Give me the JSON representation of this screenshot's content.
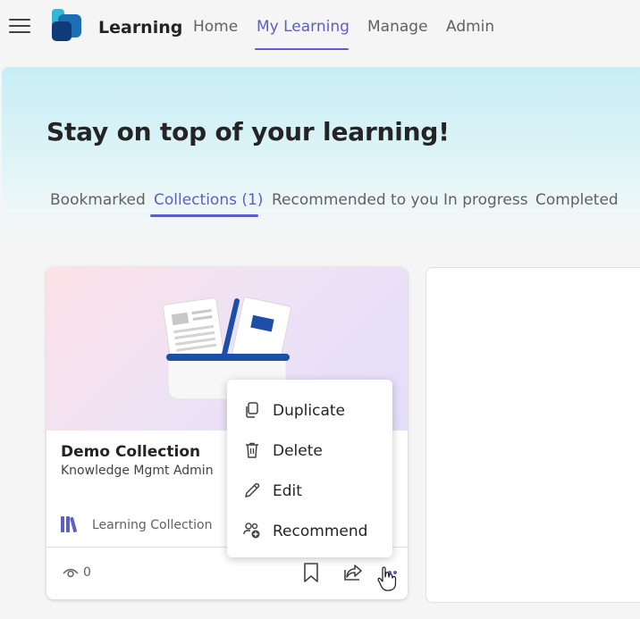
{
  "app": {
    "title": "Learning"
  },
  "nav": {
    "items": [
      {
        "label": "Home"
      },
      {
        "label": "My Learning"
      },
      {
        "label": "Manage"
      },
      {
        "label": "Admin"
      }
    ],
    "active": "My Learning"
  },
  "hero": {
    "title": "Stay on top of your learning!",
    "tabs": [
      {
        "label": "Bookmarked"
      },
      {
        "label": "Collections (1)"
      },
      {
        "label": "Recommended to you"
      },
      {
        "label": "In progress"
      },
      {
        "label": "Completed"
      }
    ],
    "active_tab": "Collections (1)"
  },
  "card": {
    "title": "Demo Collection",
    "subtitle": "Knowledge Mgmt Admin",
    "type_label": "Learning Collection",
    "view_count": "0",
    "icons": [
      "eye-icon",
      "bookmark-icon",
      "share-icon",
      "more-icon"
    ]
  },
  "menu": {
    "items": [
      {
        "label": "Duplicate",
        "icon": "copy-icon"
      },
      {
        "label": "Delete",
        "icon": "trash-icon"
      },
      {
        "label": "Edit",
        "icon": "pencil-icon"
      },
      {
        "label": "Recommend",
        "icon": "person-add-icon"
      }
    ]
  },
  "colors": {
    "accent": "#5b5fc7",
    "hero": "#c8eef5",
    "brand": "#1e4fa8"
  }
}
